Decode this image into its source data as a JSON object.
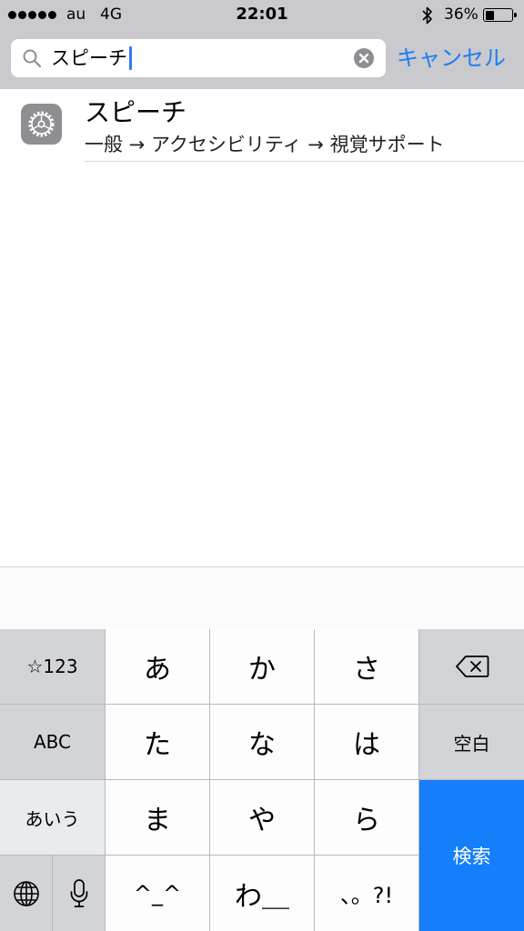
{
  "status_bar": {
    "carrier": "au",
    "network": "4G",
    "time": "22:01",
    "battery_percent": "36%",
    "battery_level": 0.36
  },
  "search": {
    "query": "スピーチ",
    "cancel_label": "キャンセル"
  },
  "results": [
    {
      "title": "スピーチ",
      "path": "一般 → アクセシビリティ → 視覚サポート",
      "icon": "settings-gear-icon"
    }
  ],
  "keyboard": {
    "row1": {
      "left": "☆123",
      "keys": [
        "あ",
        "か",
        "さ"
      ],
      "right_icon": "backspace-icon"
    },
    "row2": {
      "left": "ABC",
      "keys": [
        "た",
        "な",
        "は"
      ],
      "right": "空白"
    },
    "row3": {
      "left": "あいう",
      "keys": [
        "ま",
        "や",
        "ら"
      ]
    },
    "row4": {
      "left_icons": [
        "globe-icon",
        "microphone-icon"
      ],
      "keys": [
        "^_^",
        "わ＿",
        "、。?!"
      ]
    },
    "search_label": "検索"
  },
  "colors": {
    "accent": "#1c7cf4",
    "search_key": "#157efb",
    "top_bar": "#c9c9ce"
  }
}
